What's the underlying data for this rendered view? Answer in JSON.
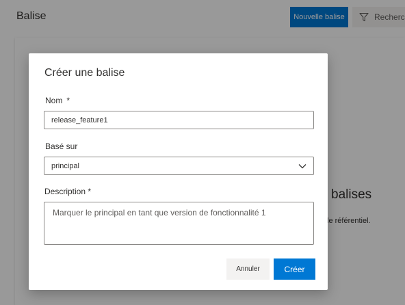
{
  "page": {
    "title": "Balise",
    "new_tag_button": "Nouvelle balise",
    "search_button": "Rechercher",
    "empty_title": "balises",
    "empty_subtitle": "le référentiel."
  },
  "dialog": {
    "title": "Créer une balise",
    "name_label": "Nom",
    "name_required": "*",
    "name_value": "release_feature1",
    "based_on_label": "Basé sur",
    "based_on_value": "principal",
    "description_label": "Description",
    "description_required": "*",
    "description_value": "Marquer le principal en tant que version de fonctionnalité 1",
    "cancel_label": "Annuler",
    "create_label": "Créer"
  },
  "colors": {
    "primary": "#0078d4",
    "overlay": "rgba(0,0,0,0.4)"
  },
  "icons": {
    "search_button_icon": "filter-icon",
    "select_icon": "chevron-down-icon"
  }
}
